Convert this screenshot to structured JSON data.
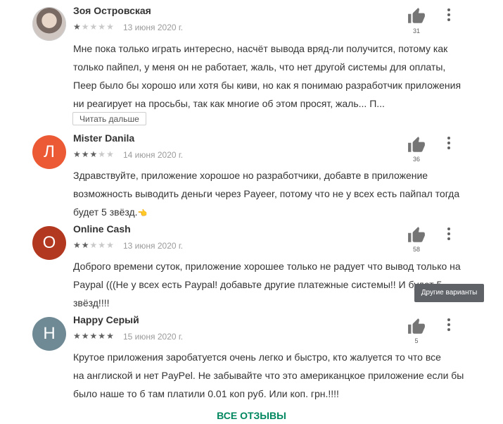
{
  "reviews": [
    {
      "name": "Зоя Островская",
      "avatar_letter": "",
      "avatar_color": "#8d8d8d",
      "rating": 1,
      "date": "13 июня 2020 г.",
      "likes": "31",
      "lines": [
        "Мне пока только играть интересно, насчёт вывода вряд-ли получится, потому как",
        "только пайпел, у меня он не работает, жаль, что нет другой системы для оплаты,",
        "Пеер было бы хорошо или хотя бы киви, но как я понимаю разработчик приложения",
        "ни реагирует на просьбы, так как многие об этом просят, жаль... П..."
      ],
      "read_more_label": "Читать дальше"
    },
    {
      "name": "Mister Danila",
      "avatar_letter": "Л",
      "avatar_color": "#ec5a35",
      "rating": 3,
      "date": "14 июня 2020 г.",
      "likes": "36",
      "lines": [
        "Здравствуйте, приложение хорошое но разработчики, добавте в приложение",
        "возможность выводить деньги через Payeer, потому что не у всех есть пайпал тогда",
        "будет 5 звёзд."
      ]
    },
    {
      "name": "Online Cash",
      "avatar_letter": "O",
      "avatar_color": "#b23820",
      "rating": 2,
      "date": "13 июня 2020 г.",
      "likes": "58",
      "lines": [
        "Доброго времени суток, приложение хорошее только не радует что вывод только на",
        "Paypal (((Не у всех есть Paypal! добавьте другие платежные системы!! И будет 5",
        "звёзд!!!!"
      ]
    },
    {
      "name": "Happy Серый",
      "avatar_letter": "H",
      "avatar_color": "#6f8a95",
      "rating": 5,
      "date": "15 июня 2020 г.",
      "likes": "5",
      "lines": [
        "Крутое приложения заробатуется очень легко и быстро, кто жалуется то что все",
        "на англиской и нет PayPel. Не забывайте что это американцкое приложение если бы",
        "было наше то б там платили 0.01 коп руб. Или коп. грн.!!!!"
      ]
    }
  ],
  "tooltip": "Другие варианты",
  "all_reviews_label": "ВСЕ ОТЗЫВЫ",
  "icons": {
    "thumb": "thumb-up-icon",
    "more": "more-vert-icon",
    "star": "star-icon"
  }
}
